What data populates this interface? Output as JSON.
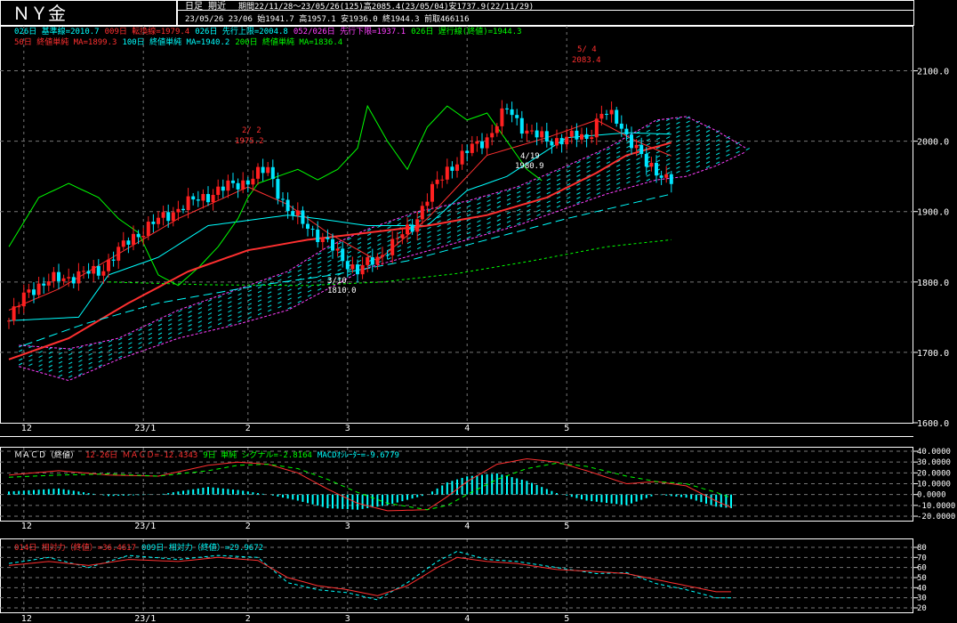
{
  "header": {
    "title": "ＮＹ金",
    "mode": "日足 期近",
    "period_line": "期間22/11/28～23/05/26(125)高2085.4(23/05/04)安1737.9(22/11/29)",
    "date_line": "23/05/26 23/06 始1941.7 高1957.1 安1936.0 終1944.3 前取466116"
  },
  "legend_row1": [
    {
      "text": "026日 基準線=2010.7",
      "color": "#00ffff"
    },
    {
      "text": "009日 転換線=1979.4",
      "color": "#ff3030"
    },
    {
      "text": "026日 先行上限=2004.8",
      "color": "#00ffff"
    },
    {
      "text": "052/026日 先行下限=1937.1",
      "color": "#ff40ff"
    },
    {
      "text": "026日 遅行線(終値)=1944.3",
      "color": "#00ff00"
    }
  ],
  "legend_row2": [
    {
      "text": "50日 終値単純 MA=1899.3",
      "color": "#ff3030"
    },
    {
      "text": "100日 終値単純 MA=1940.2",
      "color": "#00ffff"
    },
    {
      "text": "200日 終値単純 MA=1836.4",
      "color": "#00ff00"
    }
  ],
  "macd_legend": [
    {
      "text": "ＭＡＣＤ（終値）",
      "color": "#ffffff"
    },
    {
      "text": "12-26日 ＭＡＣＤ=-12.4343",
      "color": "#ff3030"
    },
    {
      "text": "9日 単純 シグナル=-2.8164",
      "color": "#00ff00"
    },
    {
      "text": "MACDｵｼﾚｰﾀｰ=-9.6779",
      "color": "#00ffff"
    }
  ],
  "rsi_legend": [
    {
      "text": "014日 相対力（終値）=36.4617",
      "color": "#ff3030"
    },
    {
      "text": "009日 相対力（終値）=29.9672",
      "color": "#00ffff"
    }
  ],
  "x_ticks": [
    "12",
    "23/1",
    "2",
    "3",
    "4",
    "5"
  ],
  "annotations": [
    {
      "text": "5/ 4",
      "color": "#ff3030"
    },
    {
      "text": "2083.4",
      "color": "#ff3030"
    },
    {
      "text": "2/ 2",
      "color": "#ff3030"
    },
    {
      "text": "1975.2",
      "color": "#ff3030"
    },
    {
      "text": "3/10",
      "color": "#ffffff"
    },
    {
      "text": "1810.0",
      "color": "#ffffff"
    },
    {
      "text": "4/19",
      "color": "#ffffff"
    },
    {
      "text": "1980.9",
      "color": "#ffffff"
    }
  ],
  "chart_data": [
    {
      "type": "candlestick",
      "title": "ＮＹ金",
      "ylim": [
        1600,
        2150
      ],
      "y_ticks": [
        "2100.0",
        "2000.0",
        "1900.0",
        "1800.0",
        "1700.0",
        "1600.0"
      ],
      "y_values": [
        2100,
        2000,
        1900,
        1800,
        1700,
        1600
      ],
      "x_ticks": [
        "12",
        "23/1",
        "2",
        "3",
        "4",
        "5"
      ],
      "close_anchors": [
        [
          0,
          1745
        ],
        [
          4,
          1790
        ],
        [
          10,
          1805
        ],
        [
          18,
          1815
        ],
        [
          25,
          1865
        ],
        [
          34,
          1905
        ],
        [
          42,
          1930
        ],
        [
          48,
          1945
        ],
        [
          52,
          1960
        ],
        [
          56,
          1900
        ],
        [
          60,
          1880
        ],
        [
          66,
          1840
        ],
        [
          70,
          1815
        ],
        [
          74,
          1835
        ],
        [
          78,
          1860
        ],
        [
          81,
          1880
        ],
        [
          84,
          1920
        ],
        [
          88,
          1960
        ],
        [
          92,
          1985
        ],
        [
          96,
          2005
        ],
        [
          100,
          2045
        ],
        [
          104,
          2015
        ],
        [
          108,
          2000
        ],
        [
          112,
          2005
        ],
        [
          116,
          2005
        ],
        [
          119,
          2040
        ],
        [
          122,
          2030
        ],
        [
          125,
          2000
        ],
        [
          128,
          1965
        ],
        [
          131,
          1955
        ],
        [
          133,
          1944
        ]
      ],
      "series": [
        {
          "name": "026日 基準線",
          "color": "#00ffff",
          "anchors": [
            [
              0,
              1745
            ],
            [
              14,
              1750
            ],
            [
              20,
              1810
            ],
            [
              30,
              1835
            ],
            [
              40,
              1880
            ],
            [
              56,
              1895
            ],
            [
              62,
              1890
            ],
            [
              72,
              1880
            ],
            [
              84,
              1880
            ],
            [
              92,
              1930
            ],
            [
              100,
              1950
            ],
            [
              112,
              2005
            ],
            [
              124,
              2012
            ],
            [
              133,
              2010
            ]
          ]
        },
        {
          "name": "009日 転換線",
          "color": "#ff3030",
          "anchors": [
            [
              0,
              1760
            ],
            [
              10,
              1790
            ],
            [
              22,
              1840
            ],
            [
              34,
              1890
            ],
            [
              48,
              1935
            ],
            [
              56,
              1910
            ],
            [
              64,
              1870
            ],
            [
              74,
              1830
            ],
            [
              84,
              1890
            ],
            [
              96,
              1980
            ],
            [
              108,
              2005
            ],
            [
              118,
              2030
            ],
            [
              126,
              2000
            ],
            [
              133,
              1979
            ]
          ]
        },
        {
          "name": "026日 遅行線",
          "color": "#00ff00",
          "anchors": [
            [
              0,
              1850
            ],
            [
              6,
              1920
            ],
            [
              12,
              1940
            ],
            [
              18,
              1920
            ],
            [
              22,
              1890
            ],
            [
              26,
              1870
            ],
            [
              30,
              1810
            ],
            [
              34,
              1795
            ],
            [
              38,
              1820
            ],
            [
              42,
              1850
            ],
            [
              46,
              1890
            ],
            [
              48,
              1920
            ],
            [
              50,
              1940
            ],
            [
              54,
              1950
            ],
            [
              58,
              1960
            ],
            [
              62,
              1945
            ],
            [
              66,
              1960
            ],
            [
              70,
              1990
            ],
            [
              72,
              2050
            ],
            [
              76,
              2000
            ],
            [
              80,
              1960
            ],
            [
              84,
              2020
            ],
            [
              88,
              2050
            ],
            [
              92,
              2030
            ],
            [
              96,
              2040
            ],
            [
              100,
              2000
            ],
            [
              104,
              1960
            ],
            [
              107,
              1944
            ]
          ]
        },
        {
          "name": "50日 終値単純 MA",
          "color": "#ff3030",
          "width": 2,
          "anchors": [
            [
              0,
              1690
            ],
            [
              12,
              1720
            ],
            [
              24,
              1770
            ],
            [
              36,
              1815
            ],
            [
              48,
              1845
            ],
            [
              60,
              1860
            ],
            [
              72,
              1870
            ],
            [
              84,
              1880
            ],
            [
              96,
              1895
            ],
            [
              108,
              1920
            ],
            [
              118,
              1955
            ],
            [
              124,
              1980
            ],
            [
              133,
              1998
            ]
          ]
        },
        {
          "name": "100日 終値単純 MA",
          "color": "#00ffff",
          "dash": "10 5",
          "anchors": [
            [
              3,
              1710
            ],
            [
              15,
              1740
            ],
            [
              30,
              1770
            ],
            [
              50,
              1795
            ],
            [
              65,
              1810
            ],
            [
              80,
              1830
            ],
            [
              96,
              1860
            ],
            [
              112,
              1890
            ],
            [
              124,
              1910
            ],
            [
              133,
              1925
            ]
          ]
        },
        {
          "name": "200日 終値単純 MA",
          "color": "#00ff00",
          "dash": "3 3",
          "anchors": [
            [
              20,
              1800
            ],
            [
              40,
              1796
            ],
            [
              60,
              1795
            ],
            [
              75,
              1800
            ],
            [
              90,
              1812
            ],
            [
              105,
              1830
            ],
            [
              120,
              1850
            ],
            [
              133,
              1860
            ]
          ]
        }
      ],
      "cloud": {
        "name": "先行スパン",
        "color": "#ff40ff",
        "upper": [
          [
            2,
            1710
          ],
          [
            12,
            1705
          ],
          [
            22,
            1720
          ],
          [
            34,
            1760
          ],
          [
            46,
            1790
          ],
          [
            56,
            1815
          ],
          [
            64,
            1850
          ],
          [
            72,
            1875
          ],
          [
            82,
            1900
          ],
          [
            92,
            1915
          ],
          [
            102,
            1935
          ],
          [
            112,
            1965
          ],
          [
            120,
            1990
          ],
          [
            130,
            2030
          ],
          [
            136,
            2035
          ],
          [
            142,
            2015
          ],
          [
            148,
            1990
          ]
        ],
        "lower": [
          [
            2,
            1680
          ],
          [
            12,
            1660
          ],
          [
            22,
            1690
          ],
          [
            34,
            1720
          ],
          [
            46,
            1740
          ],
          [
            56,
            1760
          ],
          [
            64,
            1790
          ],
          [
            72,
            1820
          ],
          [
            82,
            1840
          ],
          [
            92,
            1860
          ],
          [
            102,
            1880
          ],
          [
            112,
            1905
          ],
          [
            120,
            1925
          ],
          [
            130,
            1945
          ],
          [
            136,
            1950
          ],
          [
            142,
            1965
          ],
          [
            148,
            1985
          ]
        ]
      }
    },
    {
      "type": "line",
      "title": "ＭＡＣＤ（終値）",
      "ylim": [
        -20,
        40
      ],
      "y_ticks": [
        "40.0000",
        "30.0000",
        "20.0000",
        "10.0000",
        "0.0000",
        "-10.0000",
        "-20.0000"
      ],
      "y_values": [
        40,
        30,
        20,
        10,
        0,
        -10,
        -20
      ],
      "series": [
        {
          "name": "12-26日 ＭＡＣＤ",
          "color": "#ff3030",
          "anchors": [
            [
              0,
              18
            ],
            [
              10,
              22
            ],
            [
              20,
              18
            ],
            [
              30,
              17
            ],
            [
              40,
              27
            ],
            [
              46,
              30
            ],
            [
              52,
              28
            ],
            [
              58,
              20
            ],
            [
              64,
              5
            ],
            [
              70,
              -8
            ],
            [
              76,
              -15
            ],
            [
              84,
              -14
            ],
            [
              88,
              -2
            ],
            [
              92,
              12
            ],
            [
              98,
              28
            ],
            [
              104,
              33
            ],
            [
              110,
              30
            ],
            [
              116,
              22
            ],
            [
              124,
              10
            ],
            [
              130,
              12
            ],
            [
              136,
              8
            ],
            [
              142,
              -6
            ],
            [
              145,
              -12
            ]
          ]
        },
        {
          "name": "9日 単純 シグナル",
          "color": "#00ff00",
          "dash": "5 4",
          "anchors": [
            [
              0,
              16
            ],
            [
              10,
              18
            ],
            [
              20,
              19
            ],
            [
              30,
              17
            ],
            [
              40,
              22
            ],
            [
              46,
              27
            ],
            [
              52,
              28
            ],
            [
              58,
              24
            ],
            [
              64,
              14
            ],
            [
              70,
              2
            ],
            [
              76,
              -8
            ],
            [
              84,
              -14
            ],
            [
              88,
              -10
            ],
            [
              92,
              0
            ],
            [
              98,
              14
            ],
            [
              104,
              24
            ],
            [
              110,
              29
            ],
            [
              116,
              26
            ],
            [
              124,
              17
            ],
            [
              130,
              12
            ],
            [
              136,
              10
            ],
            [
              142,
              2
            ],
            [
              145,
              -3
            ]
          ]
        }
      ],
      "histogram": {
        "name": "MACDｵｼﾚｰﾀｰ",
        "color": "#00ffff"
      }
    },
    {
      "type": "line",
      "title": "相対力（終値）",
      "ylim": [
        20,
        80
      ],
      "y_ticks": [
        "80",
        "70",
        "60",
        "50",
        "40",
        "30",
        "20"
      ],
      "y_values": [
        80,
        70,
        60,
        50,
        40,
        30,
        20
      ],
      "series": [
        {
          "name": "014日 相対力",
          "color": "#ff3030",
          "anchors": [
            [
              0,
              62
            ],
            [
              8,
              66
            ],
            [
              16,
              62
            ],
            [
              24,
              68
            ],
            [
              34,
              66
            ],
            [
              42,
              70
            ],
            [
              50,
              67
            ],
            [
              56,
              50
            ],
            [
              62,
              42
            ],
            [
              68,
              38
            ],
            [
              74,
              32
            ],
            [
              80,
              42
            ],
            [
              86,
              60
            ],
            [
              90,
              70
            ],
            [
              96,
              66
            ],
            [
              102,
              64
            ],
            [
              110,
              58
            ],
            [
              118,
              56
            ],
            [
              124,
              54
            ],
            [
              130,
              48
            ],
            [
              136,
              42
            ],
            [
              142,
              36
            ],
            [
              145,
              36
            ]
          ]
        },
        {
          "name": "009日 相対力",
          "color": "#00ffff",
          "dash": "4 3",
          "anchors": [
            [
              0,
              64
            ],
            [
              8,
              70
            ],
            [
              16,
              60
            ],
            [
              24,
              72
            ],
            [
              34,
              68
            ],
            [
              42,
              72
            ],
            [
              50,
              70
            ],
            [
              56,
              45
            ],
            [
              62,
              38
            ],
            [
              68,
              35
            ],
            [
              74,
              28
            ],
            [
              80,
              45
            ],
            [
              86,
              66
            ],
            [
              90,
              76
            ],
            [
              96,
              68
            ],
            [
              102,
              66
            ],
            [
              110,
              60
            ],
            [
              118,
              54
            ],
            [
              124,
              55
            ],
            [
              130,
              44
            ],
            [
              136,
              38
            ],
            [
              142,
              30
            ],
            [
              145,
              30
            ]
          ]
        }
      ]
    }
  ]
}
